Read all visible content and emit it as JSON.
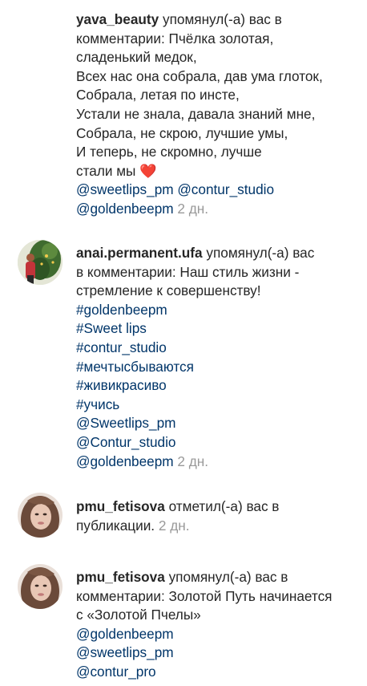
{
  "notifications": [
    {
      "username": "yava_beauty",
      "action": "упомянул(-а) вас в",
      "lines": [
        "комментарии: Пчёлка золотая,",
        "сладенький медок,",
        "Всех нас она собрала, дав ума глоток,",
        "Собрала, летая по инсте,",
        "Устали не знала, давала знаний мне,",
        "Собрала, не скрою, лучшие умы,",
        "И теперь, не скромно, лучше",
        "стали мы"
      ],
      "heart": "❤️",
      "mentions": [
        "@sweetlips_pm",
        "@contur_studio",
        "@goldenbeepm"
      ],
      "time": "2 дн."
    },
    {
      "username": "anai.permanent.ufa",
      "action": "упомянул(-а) вас",
      "lines": [
        "в комментарии: Наш стиль жизни -",
        "стремление к совершенству!"
      ],
      "hashtags": [
        "#goldenbeepm",
        "#Sweet lips",
        "#contur_studio",
        "#мечтысбываются",
        "#живикрасиво",
        "#учись"
      ],
      "mentions": [
        "@Sweetlips_pm",
        "@Contur_studio",
        "@goldenbeepm"
      ],
      "time": "2 дн."
    },
    {
      "username": "pmu_fetisova",
      "action": "отметил(-а) вас в",
      "lines": [
        "публикации."
      ],
      "time": "2 дн."
    },
    {
      "username": "pmu_fetisova",
      "action": "упомянул(-а) вас в",
      "lines": [
        "комментарии: Золотой Путь начинается",
        "с «Золотой Пчелы»"
      ],
      "mentions": [
        "@goldenbeepm",
        "@sweetlips_pm",
        "@contur_pro"
      ]
    }
  ]
}
